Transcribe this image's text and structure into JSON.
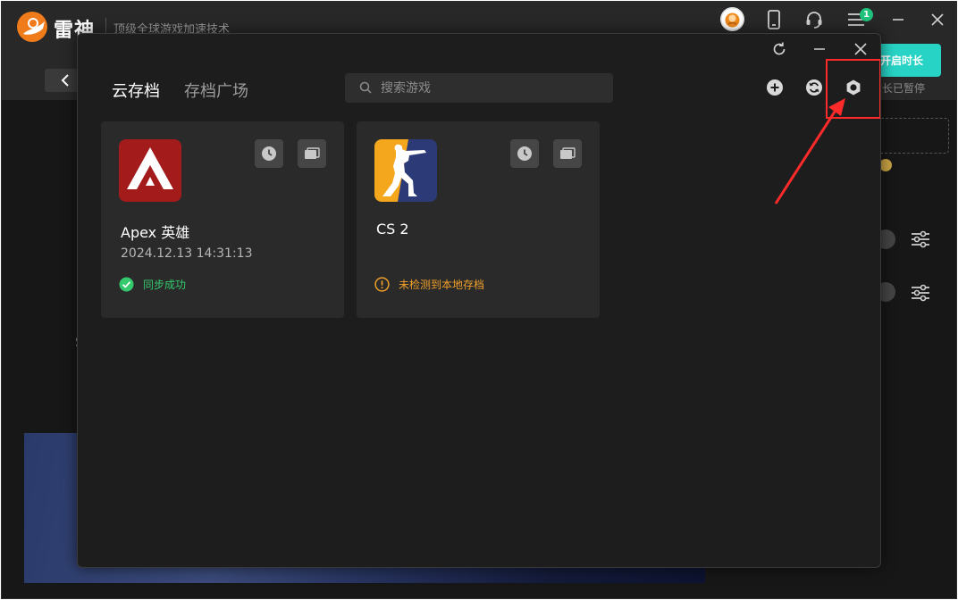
{
  "app": {
    "brand_name": "雷神",
    "slogan": "顶级全球游戏加速技术",
    "menu_badge": "1",
    "start_button_label": "开启时长",
    "pause_status": "长已暂停",
    "side_letter": "S",
    "accent_color": "#27d3c4"
  },
  "dialog": {
    "tabs": [
      {
        "label": "云存档",
        "active": true
      },
      {
        "label": "存档广场",
        "active": false
      }
    ],
    "search": {
      "placeholder": "搜索游戏"
    },
    "highlight_color": "#ff2a2a",
    "games": [
      {
        "name": "Apex 英雄",
        "time": "2024.12.13 14:31:13",
        "status": "同步成功",
        "status_type": "success",
        "icon": "apex-logo-icon"
      },
      {
        "name": "CS 2",
        "time": "",
        "status": "未检测到本地存档",
        "status_type": "warning",
        "icon": "cs2-logo-icon"
      }
    ],
    "status_colors": {
      "success": "#35c96d",
      "warning": "#f0a02a"
    }
  }
}
